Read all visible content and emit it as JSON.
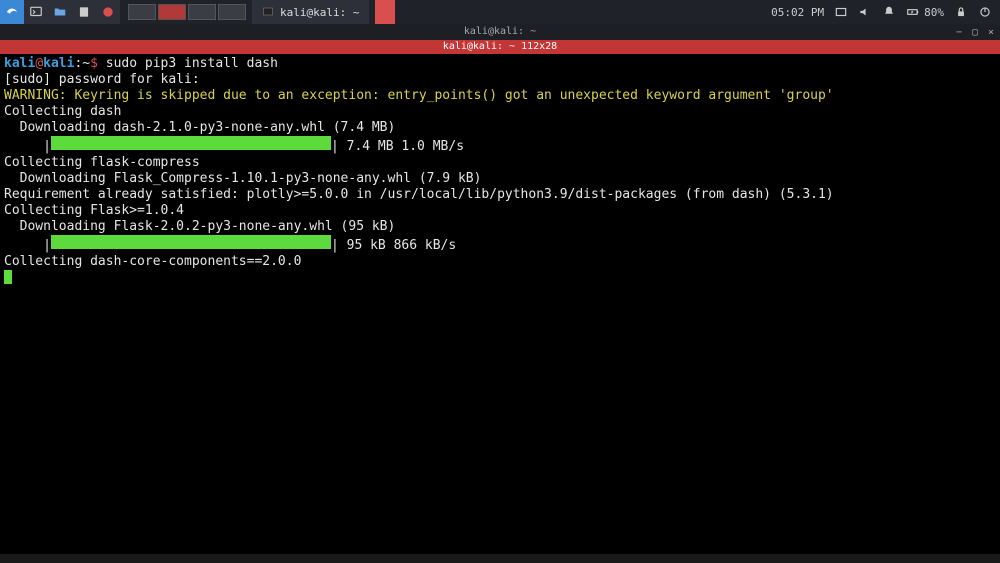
{
  "panel": {
    "task_label": "kali@kali: ~",
    "time": "05:02 PM",
    "battery_pct": "80%"
  },
  "window": {
    "title1": "kali@kali: ~",
    "title2": "kali@kali: ~  112x28"
  },
  "terminal": {
    "prompt_user": "kali",
    "prompt_sep": "@",
    "prompt_host": "kali",
    "prompt_path": ":~",
    "prompt_symbol": "$ ",
    "command": "sudo pip3 install dash",
    "sudo_line": "[sudo] password for kali:",
    "warning": "WARNING: Keyring is skipped due to an exception: entry_points() got an unexpected keyword argument 'group'",
    "l_collect_dash": "Collecting dash",
    "l_dl_dash": "  Downloading dash-2.1.0-py3-none-any.whl (7.4 MB)",
    "prog1_pre": "     |",
    "prog1_post": "| 7.4 MB 1.0 MB/s",
    "l_collect_fc": "Collecting flask-compress",
    "l_dl_fc": "  Downloading Flask_Compress-1.10.1-py3-none-any.whl (7.9 kB)",
    "l_req": "Requirement already satisfied: plotly>=5.0.0 in /usr/local/lib/python3.9/dist-packages (from dash) (5.3.1)",
    "l_collect_flask": "Collecting Flask>=1.0.4",
    "l_dl_flask": "  Downloading Flask-2.0.2-py3-none-any.whl (95 kB)",
    "prog2_pre": "     |",
    "prog2_post": "| 95 kB 866 kB/s",
    "l_collect_dcc": "Collecting dash-core-components==2.0.0"
  }
}
